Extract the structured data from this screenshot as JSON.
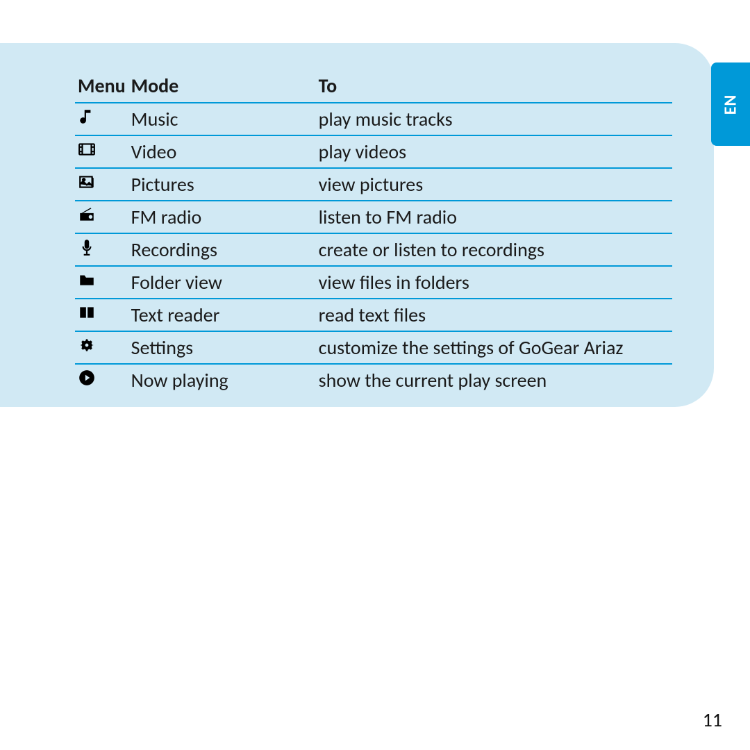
{
  "language_tab": "EN",
  "page_number": "11",
  "table": {
    "headers": {
      "menu": "Menu",
      "mode": "Mode",
      "to": "To"
    },
    "rows": [
      {
        "icon": "music-icon",
        "mode": "Music",
        "to": "play music tracks"
      },
      {
        "icon": "video-icon",
        "mode": "Video",
        "to": "play videos"
      },
      {
        "icon": "pictures-icon",
        "mode": "Pictures",
        "to": "view pictures"
      },
      {
        "icon": "radio-icon",
        "mode": "FM radio",
        "to": "listen to FM radio"
      },
      {
        "icon": "mic-icon",
        "mode": "Recordings",
        "to": "create or listen to recordings"
      },
      {
        "icon": "folder-icon",
        "mode": "Folder view",
        "to": "view files in folders"
      },
      {
        "icon": "book-icon",
        "mode": "Text reader",
        "to": "read text files"
      },
      {
        "icon": "gear-icon",
        "mode": "Settings",
        "to": "customize the settings of GoGear Ariaz"
      },
      {
        "icon": "play-circle-icon",
        "mode": "Now playing",
        "to": "show the current play screen"
      }
    ]
  }
}
